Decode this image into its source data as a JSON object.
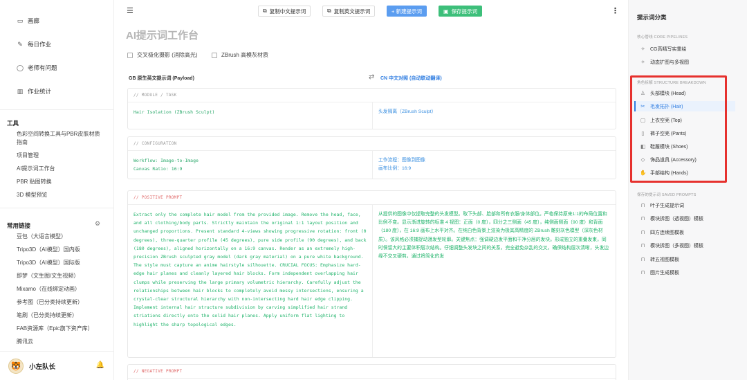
{
  "sidebar": {
    "nav": [
      {
        "icon": "image-icon",
        "glyph": "▭",
        "label": "画廊"
      },
      {
        "icon": "edit-icon",
        "glyph": "✎",
        "label": "每日作业"
      },
      {
        "icon": "chat-icon",
        "glyph": "◯",
        "label": "老师有问题"
      },
      {
        "icon": "chart-icon",
        "glyph": "▥",
        "label": "作业统计"
      }
    ],
    "tools_title": "工具",
    "tools": [
      "色彩空间转换工具与PBR皮肤材质指南",
      "项目管理",
      "AI提示词工作台",
      "PBR 贴图转换",
      "3D 模型预览"
    ],
    "links_title": "常用链接",
    "links": [
      "豆包（大语言模型）",
      "Tripo3D（AI模型）国内版",
      "Tripo3D（AI模型）国际版",
      "即梦（文生图/文生视频）",
      "Mixamo（在线绑定动画）",
      "参考图（已分类持续更新）",
      "笔刷（已分类持续更新）",
      "FAB资源库（Epic旗下资产库）",
      "腾讯云"
    ],
    "username": "小左队长"
  },
  "toolbar": {
    "menu_icon": "☰",
    "copy_cn": "复制中文提示词",
    "copy_en": "复制英文提示词",
    "new_prompt": "+ 新建提示词",
    "save_prompt": "保存提示词",
    "more": "⋮"
  },
  "main": {
    "title": "AI提示词工作台",
    "options": [
      "交叉极化摄影 (消除高光)",
      "ZBrush 高模灰材质"
    ],
    "col_en": "GB  原生英文提示词 (Payload)",
    "swap": "⇄",
    "col_cn": "CN  中文对照 (自动联动翻译)",
    "cards": [
      {
        "header": "// MODULE / TASK",
        "en": "Hair Isolation (ZBrush Sculpt)",
        "zh": "头发隔离（ZBrush Sculpt）"
      },
      {
        "header": "// CONFIGURATION",
        "en": "Workflow: Image-to-Image\nCanvas Ratio: 16:9",
        "zh": "工作流程：图像到图像\n画布比例：16:9"
      },
      {
        "header": "// POSITIVE PROMPT",
        "en": "Extract only the complete hair model from the provided image. Remove the head, face, and all clothing/body parts. Strictly maintain the original 1:1 layout position and unchanged proportions. Present standard 4-views showing progressive rotation: front (0 degrees), three-quarter profile (45 degrees), pure side profile (90 degrees), and back (180 degrees), aligned horizontally on a 16:9 canvas. Render as an extremely high-precision ZBrush sculpted gray model (dark gray material) on a pure white background. The style must capture an anime hairstyle silhouette. CRUCIAL FOCUS: Emphasize hard-edge hair planes and cleanly layered hair blocks. Form independent overlapping hair clumps while preserving the large primary volumetric hierarchy. Carefully adjust the relationships between hair blocks to completely avoid messy intersections, ensuring a crystal-clear structural hierarchy with non-intersecting hard hair edge clipping. Implement internal hair structure subdivision by carving simplified hair strand striations directly onto the solid hair planes. Apply uniform flat lighting to highlight the sharp topological edges.",
        "zh": "从提供的图像中仅提取完整的头发模型。取下头部、脸部和所有衣服/身体部位。严格保持原来1:1的布局位置和比例不变。显示渐进旋转的标准 4 视图：正面（0 度），四分之三侧面（45 度），纯侧面侧面（90 度）和背面（180 度），在 16:9 画布上水平对齐。在纯白色背景上渲染为极其高精度的 ZBrush 雕刻灰色模型（深灰色材质）。该风格必须捕捉动漫发型轮廓。关键焦点：强调硬边发平面和干净分层的发块。形成独立的重叠发束，同时保留大的主要体积层次结构。仔细调整头发块之间的关系，完全避免杂乱的交叉，确保结构层次清晰，头发边缘不交叉硬剪。通过将简化的发"
      },
      {
        "header": "// NEGATIVE PROMPT"
      }
    ]
  },
  "right": {
    "title": "提示词分类",
    "core_group": "核心管线 CORE PIPELINES",
    "core": [
      {
        "icon": "wand-icon",
        "glyph": "✧",
        "label": "CG高精写实重绘"
      },
      {
        "icon": "dynamic-icon",
        "glyph": "✧",
        "label": "动态扩图与多视图"
      }
    ],
    "structure_group": "角色拆解 STRUCTURE BREAKDOWN",
    "structure": [
      {
        "icon": "head-icon",
        "glyph": "♙",
        "label": "头部模块 (Head)"
      },
      {
        "icon": "scissors-icon",
        "glyph": "✂",
        "label": "毛发拓扑 (Hair)"
      },
      {
        "icon": "shirt-icon",
        "glyph": "▢",
        "label": "上衣空壳 (Top)"
      },
      {
        "icon": "pants-icon",
        "glyph": "▯",
        "label": "裤子空壳 (Pants)"
      },
      {
        "icon": "shoe-icon",
        "glyph": "◧",
        "label": "鞋履模块 (Shoes)"
      },
      {
        "icon": "gem-icon",
        "glyph": "◇",
        "label": "饰品道具 (Accessory)"
      },
      {
        "icon": "hand-icon",
        "glyph": "✋",
        "label": "手部结构 (Hands)"
      }
    ],
    "saved_group": "保存的提示词 SAVED PROMPTS",
    "saved": [
      "叶子生成提示词",
      "模块拆图（透视图）模板",
      "四方连续图模板",
      "模块拆图（多视图）模板",
      "转五视图模板",
      "图片生成模板"
    ],
    "saved_icon": "bookmark-icon",
    "saved_glyph": "⊓"
  },
  "colors": {
    "accent_blue": "#2f7de1",
    "green": "#3dbf7a",
    "highlight_red": "#e6312e"
  }
}
